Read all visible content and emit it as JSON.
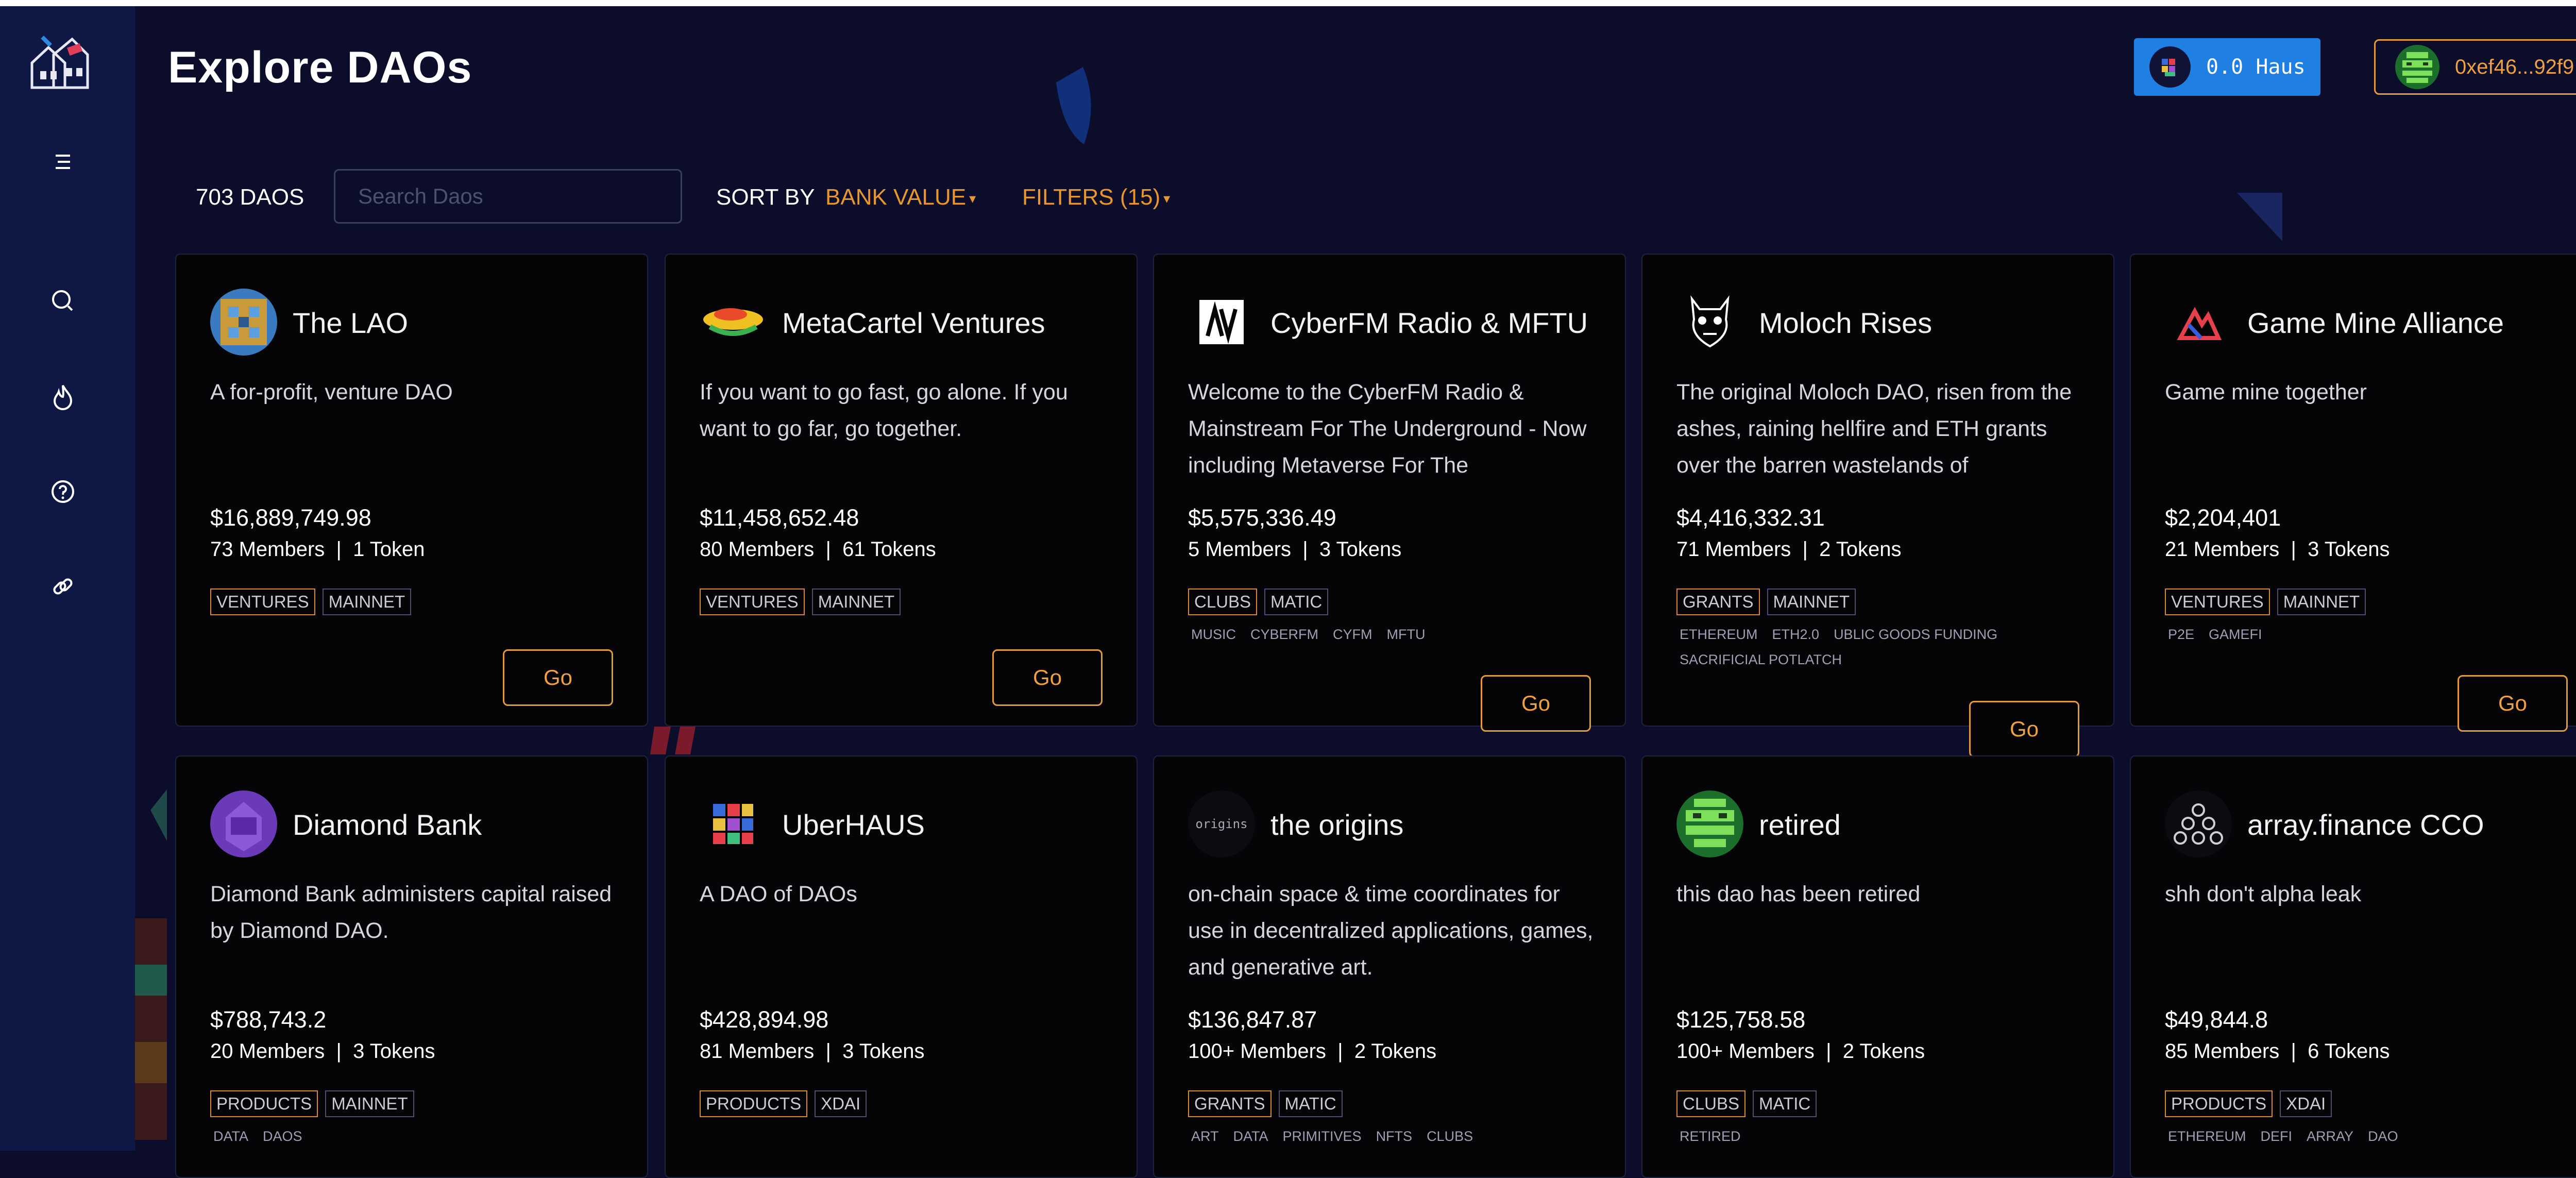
{
  "page": {
    "title": "Explore DAOs"
  },
  "header": {
    "haus_balance": "0.0 Haus",
    "wallet_address": "0xef46...92f9"
  },
  "sidebar": {
    "items": [
      {
        "name": "menu",
        "icon": "hamburger-menu-icon"
      },
      {
        "name": "explore",
        "icon": "search-icon"
      },
      {
        "name": "hot",
        "icon": "flame-icon"
      },
      {
        "name": "help",
        "icon": "help-circle-icon"
      },
      {
        "name": "link",
        "icon": "link-icon"
      }
    ]
  },
  "toolbar": {
    "count": "703 DAOS",
    "search_placeholder": "Search Daos",
    "sort_label": "SORT BY",
    "sort_value": "BANK VALUE",
    "filters_label": "FILTERS (15)"
  },
  "cards": [
    {
      "name": "The LAO",
      "description": "A for-profit, venture DAO",
      "bank": "$16,889,749.98",
      "stats": "73 Members  |  1 Token",
      "purpose": "VENTURES",
      "network": "MAINNET",
      "keywords": [],
      "go_label": "Go"
    },
    {
      "name": "MetaCartel Ventures",
      "description": "If you want to go fast, go alone. If you want to go far, go together.",
      "bank": "$11,458,652.48",
      "stats": "80 Members  |  61 Tokens",
      "purpose": "VENTURES",
      "network": "MAINNET",
      "keywords": [],
      "go_label": "Go"
    },
    {
      "name": "CyberFM Radio & MFTU",
      "description": "Welcome to the CyberFM Radio & Mainstream For The Underground - Now including Metaverse For The",
      "bank": "$5,575,336.49",
      "stats": "5 Members  |  3 Tokens",
      "purpose": "CLUBS",
      "network": "MATIC",
      "keywords": [
        "MUSIC",
        "CYBERFM",
        "CYFM",
        "MFTU"
      ],
      "go_label": "Go"
    },
    {
      "name": "Moloch Rises",
      "description": "The original Moloch DAO, risen from the ashes, raining hellfire and ETH grants over the barren wastelands of",
      "bank": "$4,416,332.31",
      "stats": "71 Members  |  2 Tokens",
      "purpose": "GRANTS",
      "network": "MAINNET",
      "keywords": [
        "ETHEREUM",
        "ETH2.0",
        "UBLIC GOODS FUNDING",
        "SACRIFICIAL POTLATCH"
      ],
      "go_label": "Go"
    },
    {
      "name": "Game Mine Alliance",
      "description": "Game mine together",
      "bank": "$2,204,401",
      "stats": "21 Members  |  3 Tokens",
      "purpose": "VENTURES",
      "network": "MAINNET",
      "keywords": [
        "P2E",
        "GAMEFI"
      ],
      "go_label": "Go"
    },
    {
      "name": "Diamond Bank",
      "description": "Diamond Bank administers capital raised by Diamond DAO.",
      "bank": "$788,743.2",
      "stats": "20 Members  |  3 Tokens",
      "purpose": "PRODUCTS",
      "network": "MAINNET",
      "keywords": [
        "DATA",
        "DAOS"
      ],
      "go_label": "Go"
    },
    {
      "name": "UberHAUS",
      "description": "A DAO of DAOs",
      "bank": "$428,894.98",
      "stats": "81 Members  |  3 Tokens",
      "purpose": "PRODUCTS",
      "network": "XDAI",
      "keywords": [],
      "go_label": "Go"
    },
    {
      "name": "the origins",
      "description": "on-chain space & time coordinates for use in decentralized applications, games, and generative art.",
      "bank": "$136,847.87",
      "stats": "100+ Members  |  2 Tokens",
      "purpose": "GRANTS",
      "network": "MATIC",
      "keywords": [
        "ART",
        "DATA",
        "PRIMITIVES",
        "NFTS",
        "CLUBS"
      ],
      "avatar_text": "origins",
      "go_label": "Go"
    },
    {
      "name": "retired",
      "description": "this dao has been retired",
      "bank": "$125,758.58",
      "stats": "100+ Members  |  2 Tokens",
      "purpose": "CLUBS",
      "network": "MATIC",
      "keywords": [
        "RETIRED"
      ],
      "go_label": "Go"
    },
    {
      "name": "array.finance CCO",
      "description": "shh don't alpha leak",
      "bank": "$49,844.8",
      "stats": "85 Members  |  6 Tokens",
      "purpose": "PRODUCTS",
      "network": "XDAI",
      "keywords": [
        "ETHEREUM",
        "DEFI",
        "ARRAY",
        "DAO"
      ],
      "go_label": "Go"
    }
  ],
  "colors": {
    "background": "#0b0d2b",
    "sidebar": "#0f1745",
    "card": "#050507",
    "accent": "#e8962e",
    "haus_button": "#1f7fe3"
  }
}
